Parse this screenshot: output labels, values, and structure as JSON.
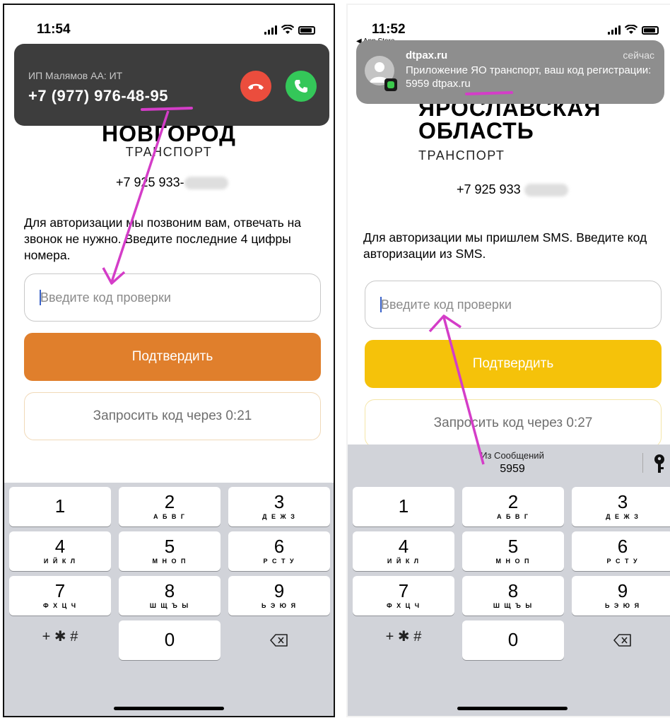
{
  "left": {
    "status": {
      "time": "11:54"
    },
    "call": {
      "caller_name": "ИП Малямов АА: ИТ",
      "number": "+7 (977) 976-48-95"
    },
    "brand": {
      "city": "НОВГОРОД",
      "subtitle": "ТРАНСПОРТ"
    },
    "phone": "+7 925 933-",
    "description": "Для авторизации мы позвоним вам, отвечать на звонок не нужно. Введите последние 4 цифры номера.",
    "input": {
      "placeholder": "Введите код проверки"
    },
    "confirm_label": "Подтвердить",
    "resend_label": "Запросить код через 0:21",
    "colors": {
      "accent": "#e07f2c",
      "secondary_border": "#f0d9b8",
      "annotation": "#d43dc8"
    }
  },
  "right": {
    "status": {
      "time": "11:52",
      "back_app": "◀ App Store"
    },
    "notification": {
      "sender": "dtpax.ru",
      "time": "сейчас",
      "body": "Приложение ЯО транспорт, ваш код регистрации: 5959 dtpax.ru"
    },
    "brand": {
      "region_line1": "ЯРОСЛАВСКАЯ",
      "region_line2": "ОБЛАСТЬ",
      "subtitle": "ТРАНСПОРТ"
    },
    "phone": "+7 925 933",
    "description": "Для авторизации мы пришлем SMS. Введите код авторизации из SMS.",
    "input": {
      "placeholder": "Введите код проверки"
    },
    "confirm_label": "Подтвердить",
    "resend_label": "Запросить код через 0:27",
    "suggestion": {
      "label": "Из Сообщений",
      "code": "5959"
    },
    "colors": {
      "accent": "#f5c20a",
      "secondary_border": "#f5e6a8",
      "annotation": "#d43dc8"
    }
  },
  "keypad": {
    "keys": [
      {
        "digit": "1",
        "letters": ""
      },
      {
        "digit": "2",
        "letters": "А Б В Г"
      },
      {
        "digit": "3",
        "letters": "Д Е Ж З"
      },
      {
        "digit": "4",
        "letters": "И Й К Л"
      },
      {
        "digit": "5",
        "letters": "М Н О П"
      },
      {
        "digit": "6",
        "letters": "Р С Т У"
      },
      {
        "digit": "7",
        "letters": "Ф Х Ц Ч"
      },
      {
        "digit": "8",
        "letters": "Ш Щ Ъ Ы"
      },
      {
        "digit": "9",
        "letters": "Ь Э Ю Я"
      }
    ],
    "symbols": "+ ✱ #",
    "zero": "0",
    "delete_icon": "backspace-icon"
  }
}
